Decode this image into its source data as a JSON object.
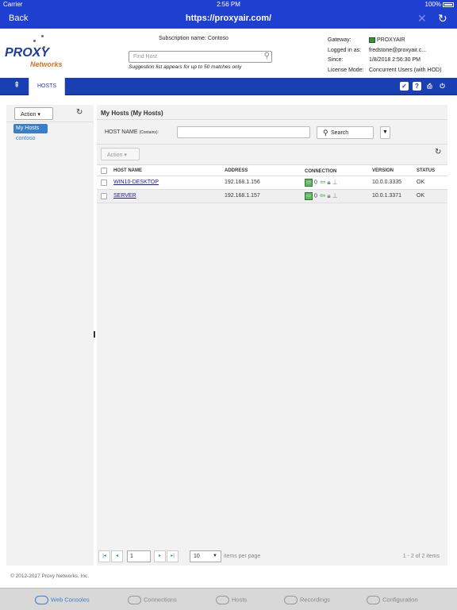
{
  "status_bar": {
    "carrier": "Carrier",
    "time": "2:56 PM",
    "battery": "100%"
  },
  "nav": {
    "back_label": "Back",
    "url": "https://proxyair.com/",
    "close_icon": "close-icon",
    "refresh_icon": "refresh-icon"
  },
  "logo": {
    "proxy": "PROXY",
    "networks": "Networks"
  },
  "header": {
    "subscription": "Subscription name: Contoso",
    "find_host_placeholder": "Find Host",
    "suggestion_note": "Suggestion list appears for up to 50 matches only",
    "gateway_label": "Gateway:",
    "gateway_value": "PROXYAIR",
    "logged_label": "Logged in as:",
    "logged_value": "fredstone@proxyair.c...",
    "since_label": "Since:",
    "since_value": "1/8/2018 2:56:30 PM",
    "license_label": "License Mode:",
    "license_value": "Concurrent Users (with HOD)"
  },
  "tabbar": {
    "hosts_tab": "HOSTS"
  },
  "left": {
    "action_label": "Action",
    "items": [
      "My Hosts",
      "contoso"
    ]
  },
  "right": {
    "title": "My Hosts (My Hosts)",
    "host_name_label": "HOST NAME",
    "host_name_contains": "(Contains):",
    "search_label": "Search",
    "action_label": "Action",
    "columns": {
      "host_name": "HOST NAME",
      "address": "ADDRESS",
      "connection": "CONNECTION",
      "version": "VERSION",
      "status": "STATUS"
    },
    "rows": [
      {
        "host": "WIN10-DESKTOP",
        "address": "192.168.1.156",
        "connections": "0",
        "version": "10.0.0.3335",
        "status": "OK"
      },
      {
        "host": "SERVER",
        "address": "192.168.1.157",
        "connections": "0",
        "version": "10.0.1.3371",
        "status": "OK"
      }
    ]
  },
  "pager": {
    "page": "1",
    "per_page": "10",
    "per_page_label": "items per page",
    "range": "1 - 2 of 2 items"
  },
  "footer": {
    "copyright": "© 2012-2017 Proxy Networks, Inc."
  },
  "bottom_tabs": [
    "Web Consoles",
    "Connections",
    "Hosts",
    "Recordings",
    "Configuration"
  ],
  "colors": {
    "primary": "#1f3fd1",
    "tabbar": "#1a3fb3",
    "accent": "#3b7fc9",
    "logo_orange": "#e07020"
  }
}
